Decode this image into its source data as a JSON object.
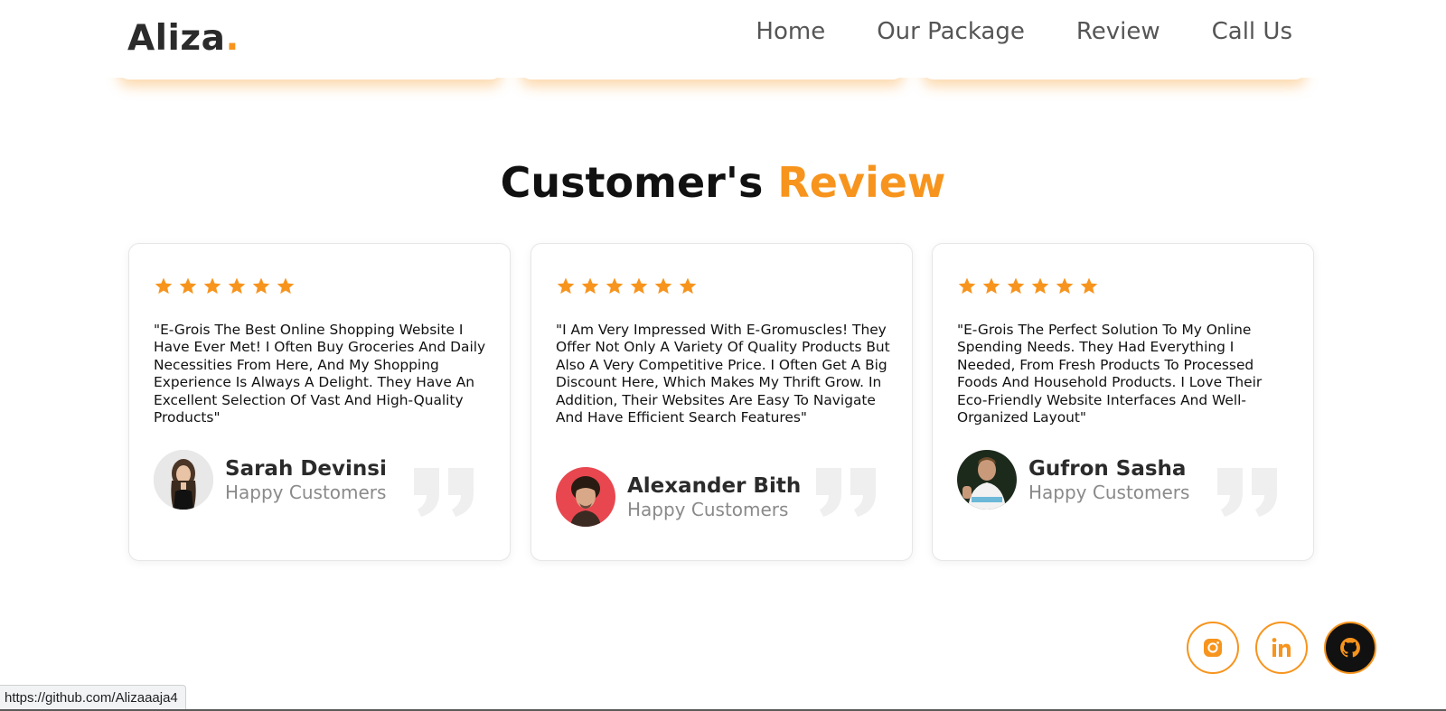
{
  "header": {
    "logo_text": "Aliza",
    "logo_dot": ".",
    "nav": [
      "Home",
      "Our Package",
      "Review",
      "Call Us"
    ]
  },
  "section": {
    "title_main": "Customer's ",
    "title_accent": "Review"
  },
  "reviews": [
    {
      "stars": 6,
      "text": "\"E-Grois The Best Online Shopping Website I Have Ever Met! I Often Buy Groceries And Daily Necessities From Here, And My Shopping Experience Is Always A Delight. They Have An Excellent Selection Of Vast And High-Quality Products\"",
      "name": "Sarah Devinsi",
      "role": "Happy Customers"
    },
    {
      "stars": 6,
      "text": "\"I Am Very Impressed With E-Gromuscles! They Offer Not Only A Variety Of Quality Products But Also A Very Competitive Price. I Often Get A Big Discount Here, Which Makes My Thrift Grow. In Addition, Their Websites Are Easy To Navigate And Have Efficient Search Features\"",
      "name": "Alexander Bith",
      "role": "Happy Customers"
    },
    {
      "stars": 6,
      "text": "\"E-Grois The Perfect Solution To My Online Spending Needs. They Had Everything I Needed, From Fresh Products To Processed Foods And Household Products. I Love Their Eco-Friendly Website Interfaces And Well-Organized Layout\"",
      "name": "Gufron Sasha",
      "role": "Happy Customers"
    }
  ],
  "socials": [
    "instagram-icon",
    "linkedin-icon",
    "github-icon"
  ],
  "status_bar": {
    "url": "https://github.com/Alizaaaja4"
  },
  "colors": {
    "accent": "#f7941d",
    "text_dark": "#2b2b2b",
    "muted": "#8a8a8a"
  }
}
